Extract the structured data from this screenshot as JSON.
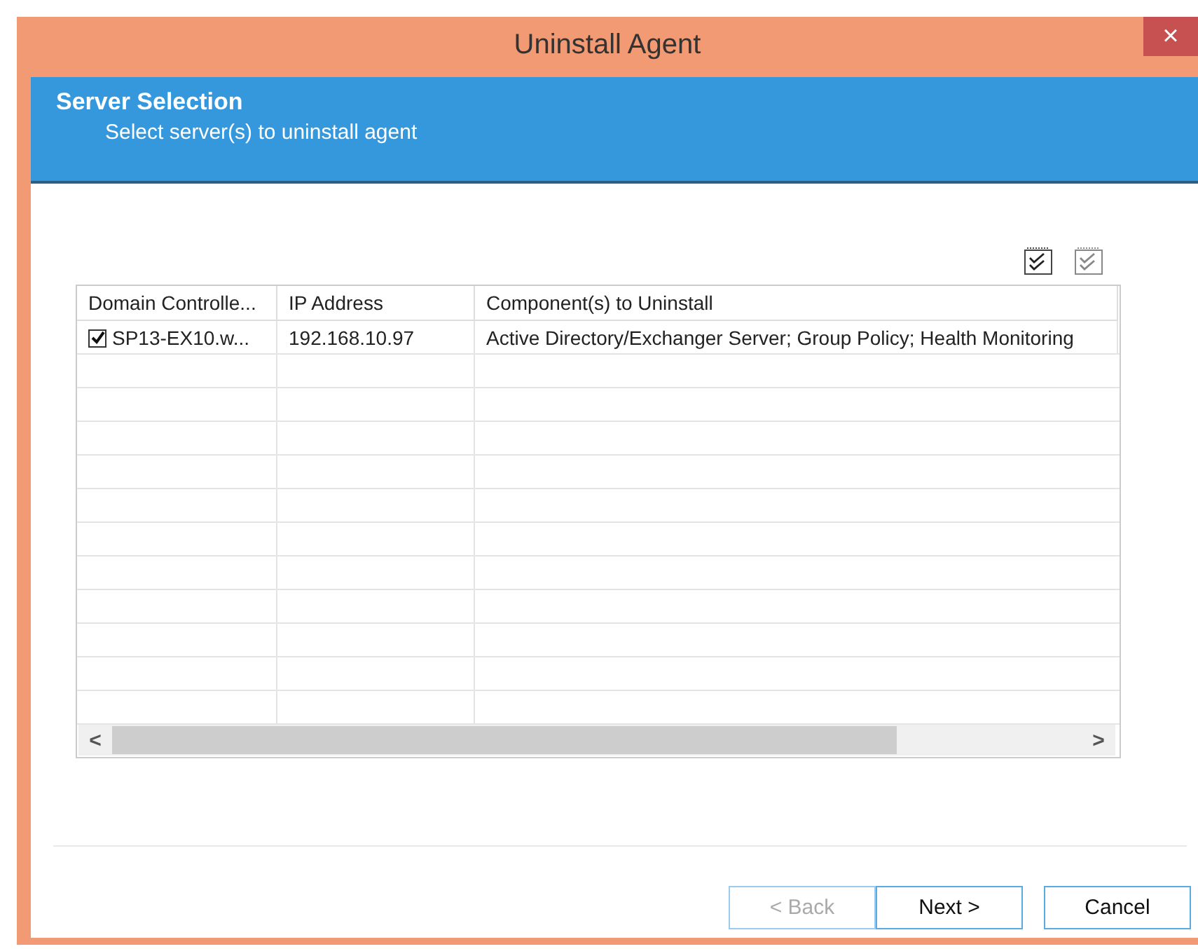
{
  "window": {
    "title": "Uninstall Agent",
    "close": "×"
  },
  "header": {
    "title": "Server Selection",
    "subtitle": "Select server(s) to uninstall agent"
  },
  "table": {
    "columns": [
      "Domain Controlle...",
      "IP Address",
      "Component(s) to Uninstall"
    ],
    "rows": [
      {
        "checked": true,
        "cells": [
          "SP13-EX10.w...",
          "192.168.10.97",
          "Active Directory/Exchanger Server; Group Policy; Health Monitoring"
        ]
      }
    ],
    "scroll_left": "<",
    "scroll_right": ">"
  },
  "buttons": [
    {
      "label": "< Back",
      "disabled": true
    },
    {
      "label": "Next >",
      "disabled": false
    },
    {
      "label": "Cancel",
      "disabled": false
    }
  ]
}
